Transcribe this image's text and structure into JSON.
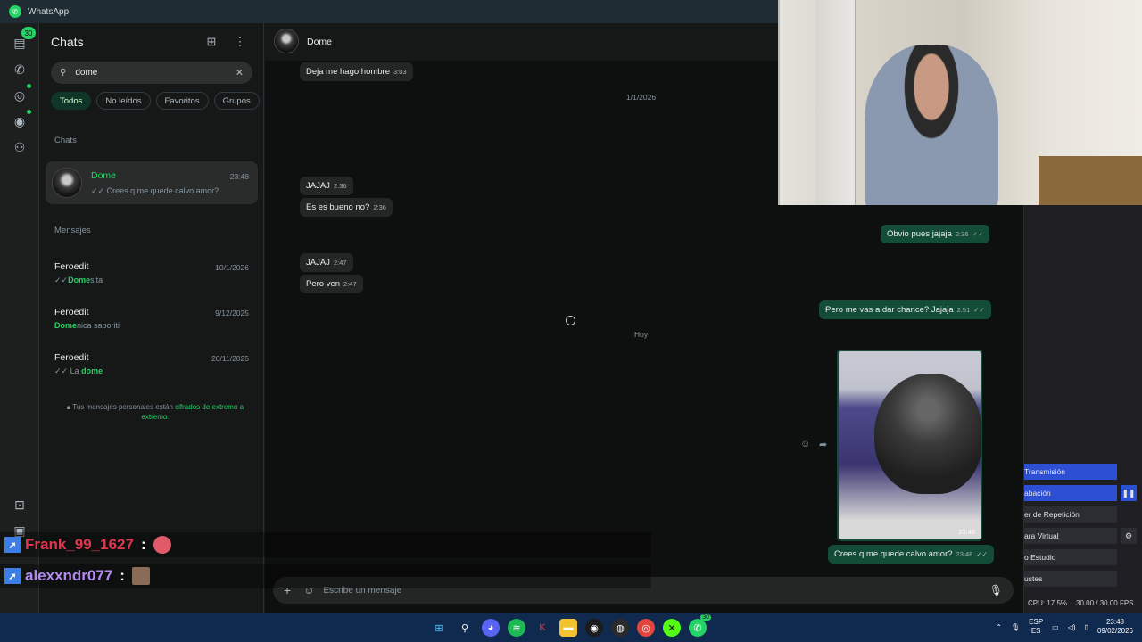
{
  "app": {
    "title": "WhatsApp"
  },
  "rail": {
    "chats_badge": "30"
  },
  "chatlist": {
    "title": "Chats",
    "search": {
      "value": "dome"
    },
    "filters": [
      "Todos",
      "No leídos",
      "Favoritos",
      "Grupos"
    ],
    "section_chats": "Chats",
    "selected_chat": {
      "name": "Dome",
      "time": "23:48",
      "preview": "Crees q me quede calvo amor?"
    },
    "section_messages": "Mensajes",
    "messages": [
      {
        "name": "Feroedit",
        "date": "10/1/2026",
        "pre": "",
        "highlight": "Dome",
        "post": "sita",
        "ticks": "✓✓"
      },
      {
        "name": "Feroedit",
        "date": "9/12/2025",
        "pre": "",
        "highlight": "Dome",
        "post": "nica saporiti",
        "ticks": ""
      },
      {
        "name": "Feroedit",
        "date": "20/11/2025",
        "pre": "La ",
        "highlight": "dome",
        "post": "",
        "ticks": "✓✓"
      }
    ],
    "e2e_text": "Tus mensajes personales están ",
    "e2e_link": "cifrados de extremo a extremo",
    "e2e_end": "."
  },
  "conversation": {
    "contact": "Dome",
    "messages": [
      {
        "text": "Deja me hago hombre",
        "time": "3:03",
        "dir": "in"
      },
      {
        "text": "JAJAJ",
        "time": "2:36",
        "dir": "in"
      },
      {
        "text": "Es es bueno no?",
        "time": "2:36",
        "dir": "in"
      },
      {
        "text": "JAJAJ",
        "time": "2:47",
        "dir": "in"
      },
      {
        "text": "Pero ven",
        "time": "2:47",
        "dir": "in"
      },
      {
        "text": "Obvio pues jajaja",
        "time": "2:36",
        "dir": "out"
      },
      {
        "text": "Pero me vas a dar chance? Jajaja",
        "time": "2:51",
        "dir": "out"
      },
      {
        "text": "Crees q me quede calvo amor?",
        "time": "23:48",
        "dir": "out"
      }
    ],
    "date_sep_1": "1/1/2026",
    "date_sep_2": "Hoy",
    "photo_time": "23:48",
    "composer_placeholder": "Escribe un mensaje"
  },
  "stream_overlay": [
    {
      "user": "Frank_99_1627",
      "colon": ":"
    },
    {
      "user": "alexxndr077",
      "colon": ":"
    }
  ],
  "obs": {
    "buttons": [
      "Transmisión",
      "abación",
      "er de Repetición",
      "ara Virtual",
      "o Estudio",
      "ustes"
    ],
    "status_cpu": "CPU: 17.5%",
    "status_fps": "30.00 / 30.00 FPS"
  },
  "taskbar": {
    "lang_top": "ESP",
    "lang_bottom": "ES",
    "time": "23:48",
    "date": "09/02/2026",
    "whatsapp_badge": "30"
  },
  "colors": {
    "accent": "#25d366",
    "outgoing": "#144d37",
    "taskbar": "#10294f",
    "obs_blue": "#2c4fd4"
  }
}
